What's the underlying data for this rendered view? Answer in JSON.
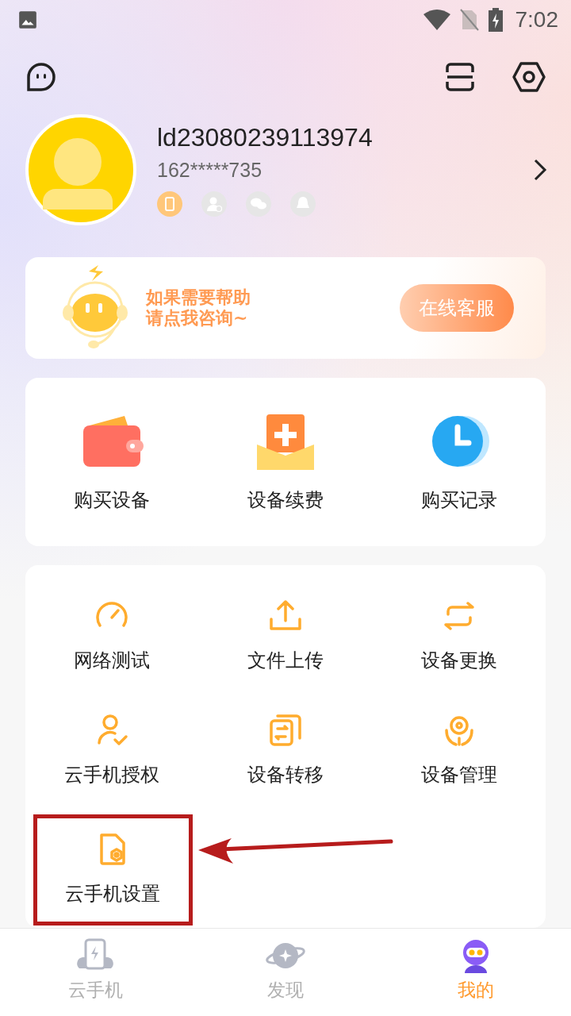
{
  "status_bar": {
    "time": "7:02"
  },
  "profile": {
    "user_id": "ld23080239113974",
    "phone": "162*****735",
    "bindings": [
      {
        "kind": "phone",
        "bound": true
      },
      {
        "kind": "account",
        "bound": false
      },
      {
        "kind": "wechat",
        "bound": false
      },
      {
        "kind": "qq",
        "bound": false
      }
    ]
  },
  "help_card": {
    "lines": [
      "如果需要帮助",
      "请点我咨询~"
    ],
    "button": "在线客服"
  },
  "purchase_section": {
    "items": [
      {
        "kind": "wallet",
        "label": "购买设备"
      },
      {
        "kind": "renew",
        "label": "设备续费"
      },
      {
        "kind": "clock",
        "label": "购买记录"
      }
    ]
  },
  "tools_section": {
    "items": [
      {
        "kind": "speed",
        "label": "网络测试",
        "highlighted": false
      },
      {
        "kind": "upload",
        "label": "文件上传",
        "highlighted": false
      },
      {
        "kind": "swap",
        "label": "设备更换",
        "highlighted": false
      },
      {
        "kind": "user",
        "label": "云手机授权",
        "highlighted": false
      },
      {
        "kind": "transfer",
        "label": "设备转移",
        "highlighted": false
      },
      {
        "kind": "manage",
        "label": "设备管理",
        "highlighted": false
      },
      {
        "kind": "settings",
        "label": "云手机设置",
        "highlighted": true
      }
    ]
  },
  "bottom_nav": [
    {
      "kind": "cloud",
      "label": "云手机",
      "selected": false
    },
    {
      "kind": "planet",
      "label": "发现",
      "selected": false
    },
    {
      "kind": "robot",
      "label": "我的",
      "selected": true
    }
  ]
}
